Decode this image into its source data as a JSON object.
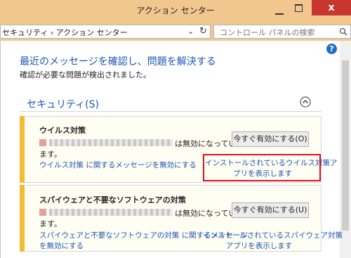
{
  "window": {
    "title": "アクション センター",
    "close_glyph": "x"
  },
  "address": {
    "path": "セキュリティ › アクション センター",
    "search_placeholder": "コントロール パネルの検索"
  },
  "page": {
    "heading": "最近のメッセージを確認し、問題を解決する",
    "subheading": "確認が必要な問題が検出されました。",
    "help": "?"
  },
  "security": {
    "title": "セキュリティ(S)",
    "cards": [
      {
        "title": "ウイルス対策",
        "status_line1": "は無効になってい",
        "status_line2": "ます。",
        "button": "今すぐ有効にする(O)",
        "link_left": "ウイルス対策 に関するメッセージを無効にする",
        "link_right_line1": "インストールされているウイルス対策ア",
        "link_right_line2": "プリを表示します"
      },
      {
        "title": "スパイウェアと不要なソフトウェアの対策",
        "status_line1": "は無効になってい",
        "status_line2": "ます。",
        "button": "今すぐ有効にする(U)",
        "link_left_line1": "スパイウェアと不要なソフトウェアの対策 に関するメッセージ",
        "link_left_line2": "を無効にする",
        "link_right_line1": "インストールされているスパイウェア対策",
        "link_right_line2": "アプリを表示します"
      }
    ]
  },
  "colors": {
    "titlebar": "#f2c68f",
    "accent_link": "#1a56b0",
    "warning_stripe": "#f6ba33",
    "highlight": "#e01020"
  }
}
